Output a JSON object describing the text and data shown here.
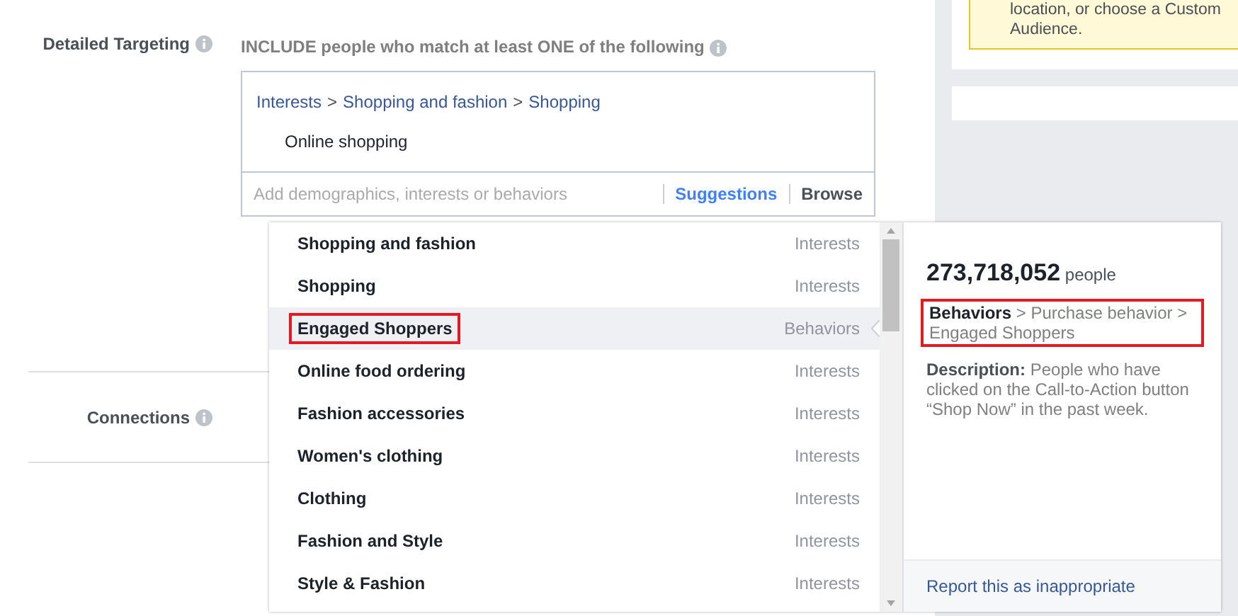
{
  "notice": {
    "lines": [
      "location, or choose a Custom",
      "Audience."
    ]
  },
  "detailed_targeting": {
    "label": "Detailed Targeting",
    "include_text": "INCLUDE people who match at least ONE of the following",
    "path": [
      "Interests",
      "Shopping and fashion",
      "Shopping"
    ],
    "separator": ">",
    "selected_item": "Online shopping",
    "search": {
      "placeholder": "Add demographics, interests or behaviors"
    },
    "tabs": [
      {
        "label": "Suggestions",
        "selected": true
      },
      {
        "label": "Browse",
        "selected": false
      }
    ]
  },
  "connections": {
    "label": "Connections"
  },
  "suggestions": [
    {
      "name": "Shopping and fashion",
      "category": "Interests",
      "selected": false,
      "outlined": false
    },
    {
      "name": "Shopping",
      "category": "Interests",
      "selected": false,
      "outlined": false
    },
    {
      "name": "Engaged Shoppers",
      "category": "Behaviors",
      "selected": true,
      "outlined": true
    },
    {
      "name": "Online food ordering",
      "category": "Interests",
      "selected": false,
      "outlined": false
    },
    {
      "name": "Fashion accessories",
      "category": "Interests",
      "selected": false,
      "outlined": false
    },
    {
      "name": "Women's clothing",
      "category": "Interests",
      "selected": false,
      "outlined": false
    },
    {
      "name": "Clothing",
      "category": "Interests",
      "selected": false,
      "outlined": false
    },
    {
      "name": "Fashion and Style",
      "category": "Interests",
      "selected": false,
      "outlined": false
    },
    {
      "name": "Style & Fashion",
      "category": "Interests",
      "selected": false,
      "outlined": false
    }
  ],
  "details": {
    "count": "273,718,052",
    "unit": "people",
    "path": "**Behaviors** > Purchase behavior > Engaged Shoppers",
    "path_outlined": true,
    "description": "**Description:** People who have clicked on the Call-to-Action button “Shop Now” in the past week.",
    "report_link": "Report this as inappropriate"
  }
}
